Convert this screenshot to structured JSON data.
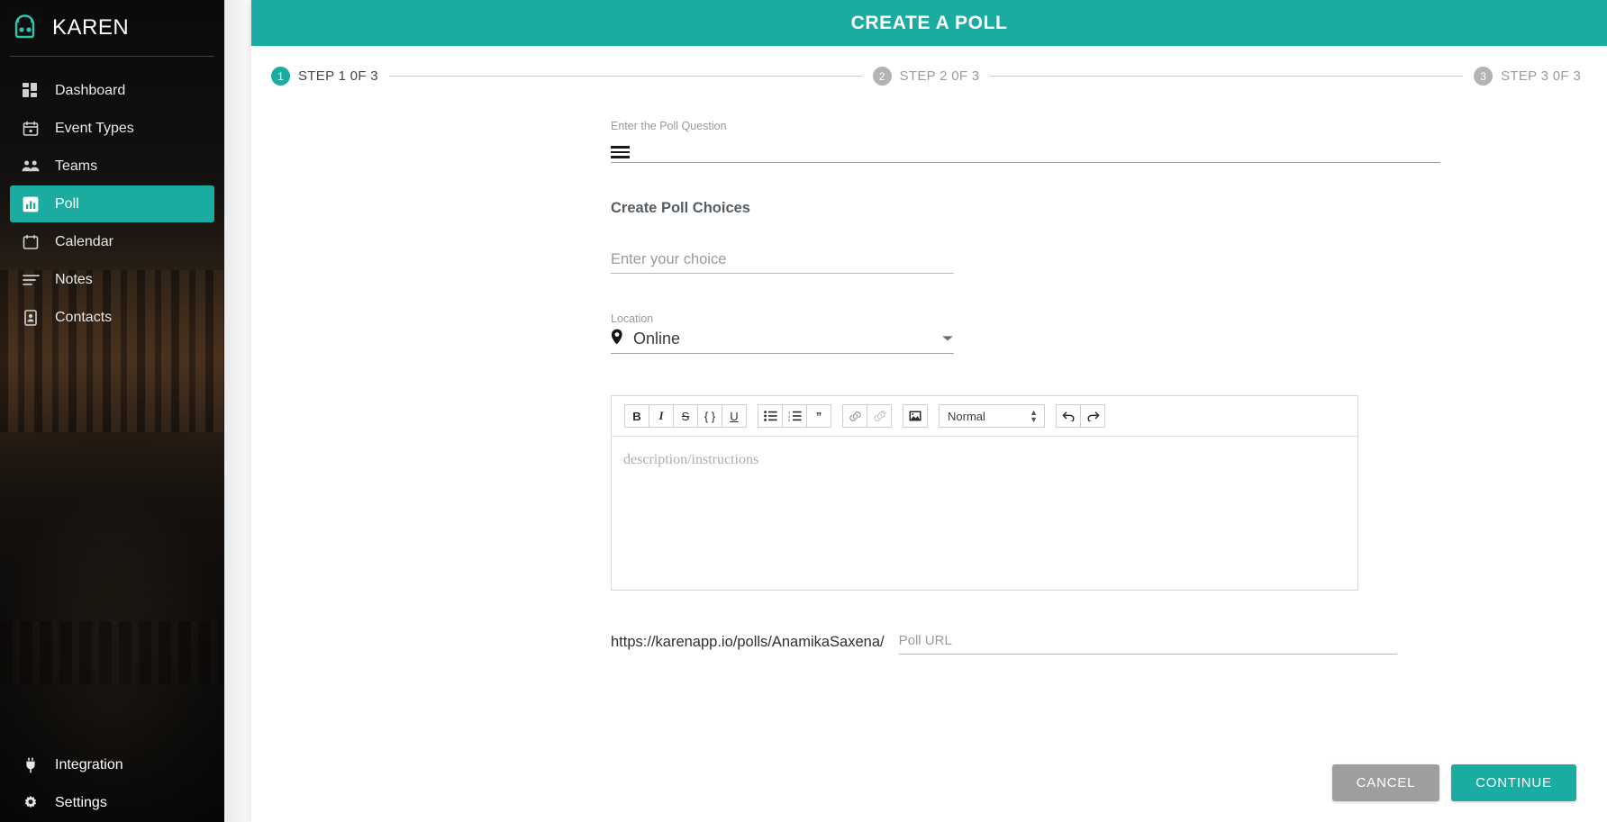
{
  "brand": {
    "name": "KAREN",
    "logo_icon": "robot-logo-icon"
  },
  "sidebar": {
    "items": [
      {
        "label": "Dashboard",
        "icon": "dashboard-grid-icon",
        "active": false
      },
      {
        "label": "Event Types",
        "icon": "calendar-event-icon",
        "active": false
      },
      {
        "label": "Teams",
        "icon": "people-group-icon",
        "active": false
      },
      {
        "label": "Poll",
        "icon": "bar-chart-icon",
        "active": true
      },
      {
        "label": "Calendar",
        "icon": "calendar-icon",
        "active": false
      },
      {
        "label": "Notes",
        "icon": "lines-notes-icon",
        "active": false
      },
      {
        "label": "Contacts",
        "icon": "contact-card-icon",
        "active": false
      }
    ],
    "bottom_items": [
      {
        "label": "Integration",
        "icon": "plug-icon"
      },
      {
        "label": "Settings",
        "icon": "gear-icon"
      }
    ]
  },
  "header": {
    "title": "CREATE A POLL",
    "accent_color": "#1aaca0"
  },
  "stepper": {
    "steps": [
      {
        "number": "1",
        "label": "STEP 1 0F 3",
        "active": true
      },
      {
        "number": "2",
        "label": "STEP 2 0F 3",
        "active": false
      },
      {
        "number": "3",
        "label": "STEP 3 0F 3",
        "active": false
      }
    ]
  },
  "form": {
    "question": {
      "label": "Enter the Poll Question",
      "value": "",
      "placeholder": ""
    },
    "choices_heading": "Create Poll Choices",
    "choice": {
      "value": "",
      "placeholder": "Enter your choice"
    },
    "location": {
      "label": "Location",
      "value": "Online",
      "pin_icon": "map-pin-icon",
      "caret_icon": "chevron-down-icon"
    },
    "editor": {
      "placeholder": "description/instructions",
      "content": "",
      "toolbar": {
        "bold": "B",
        "italic": "I",
        "strike": "S",
        "code": "{ }",
        "underline": "U",
        "bullet_list": "bullet-list-icon",
        "ordered_list": "numbered-list-icon",
        "blockquote": "”",
        "link": "link-icon",
        "unlink": "unlink-icon",
        "image": "image-icon",
        "format_value": "Normal",
        "undo": "undo-icon",
        "redo": "redo-icon"
      }
    },
    "poll_url": {
      "prefix": "https://karenapp.io/polls/AnamikaSaxena/",
      "value": "",
      "placeholder": "Poll URL"
    }
  },
  "actions": {
    "cancel": "CANCEL",
    "continue": "CONTINUE"
  }
}
